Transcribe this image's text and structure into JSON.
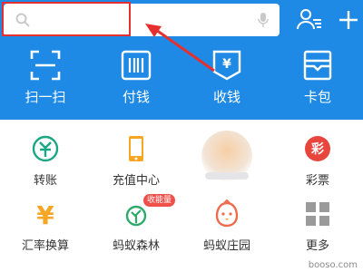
{
  "search": {
    "placeholder": ""
  },
  "header_icons": [
    "contacts-icon",
    "plus-icon"
  ],
  "quick_actions": [
    {
      "label": "扫一扫",
      "icon": "scan-icon"
    },
    {
      "label": "付钱",
      "icon": "barcode-icon"
    },
    {
      "label": "收钱",
      "icon": "receive-money-icon"
    },
    {
      "label": "卡包",
      "icon": "card-wallet-icon"
    }
  ],
  "services": [
    {
      "label": "转账",
      "icon": "transfer-icon"
    },
    {
      "label": "充值中心",
      "icon": "phone-topup-icon"
    },
    {
      "label": "",
      "icon": "blurred-icon"
    },
    {
      "label": "彩票",
      "icon": "lottery-icon",
      "glyph": "彩"
    },
    {
      "label": "汇率换算",
      "icon": "exchange-rate-icon",
      "glyph": "¥"
    },
    {
      "label": "蚂蚁森林",
      "icon": "ant-forest-icon",
      "badge": "收能量"
    },
    {
      "label": "蚂蚁庄园",
      "icon": "ant-farm-icon"
    },
    {
      "label": "更多",
      "icon": "more-grid-icon"
    }
  ],
  "colors": {
    "header_blue": "#1E8AE6",
    "highlight_red": "#E5302F"
  },
  "watermark": "booso.com"
}
